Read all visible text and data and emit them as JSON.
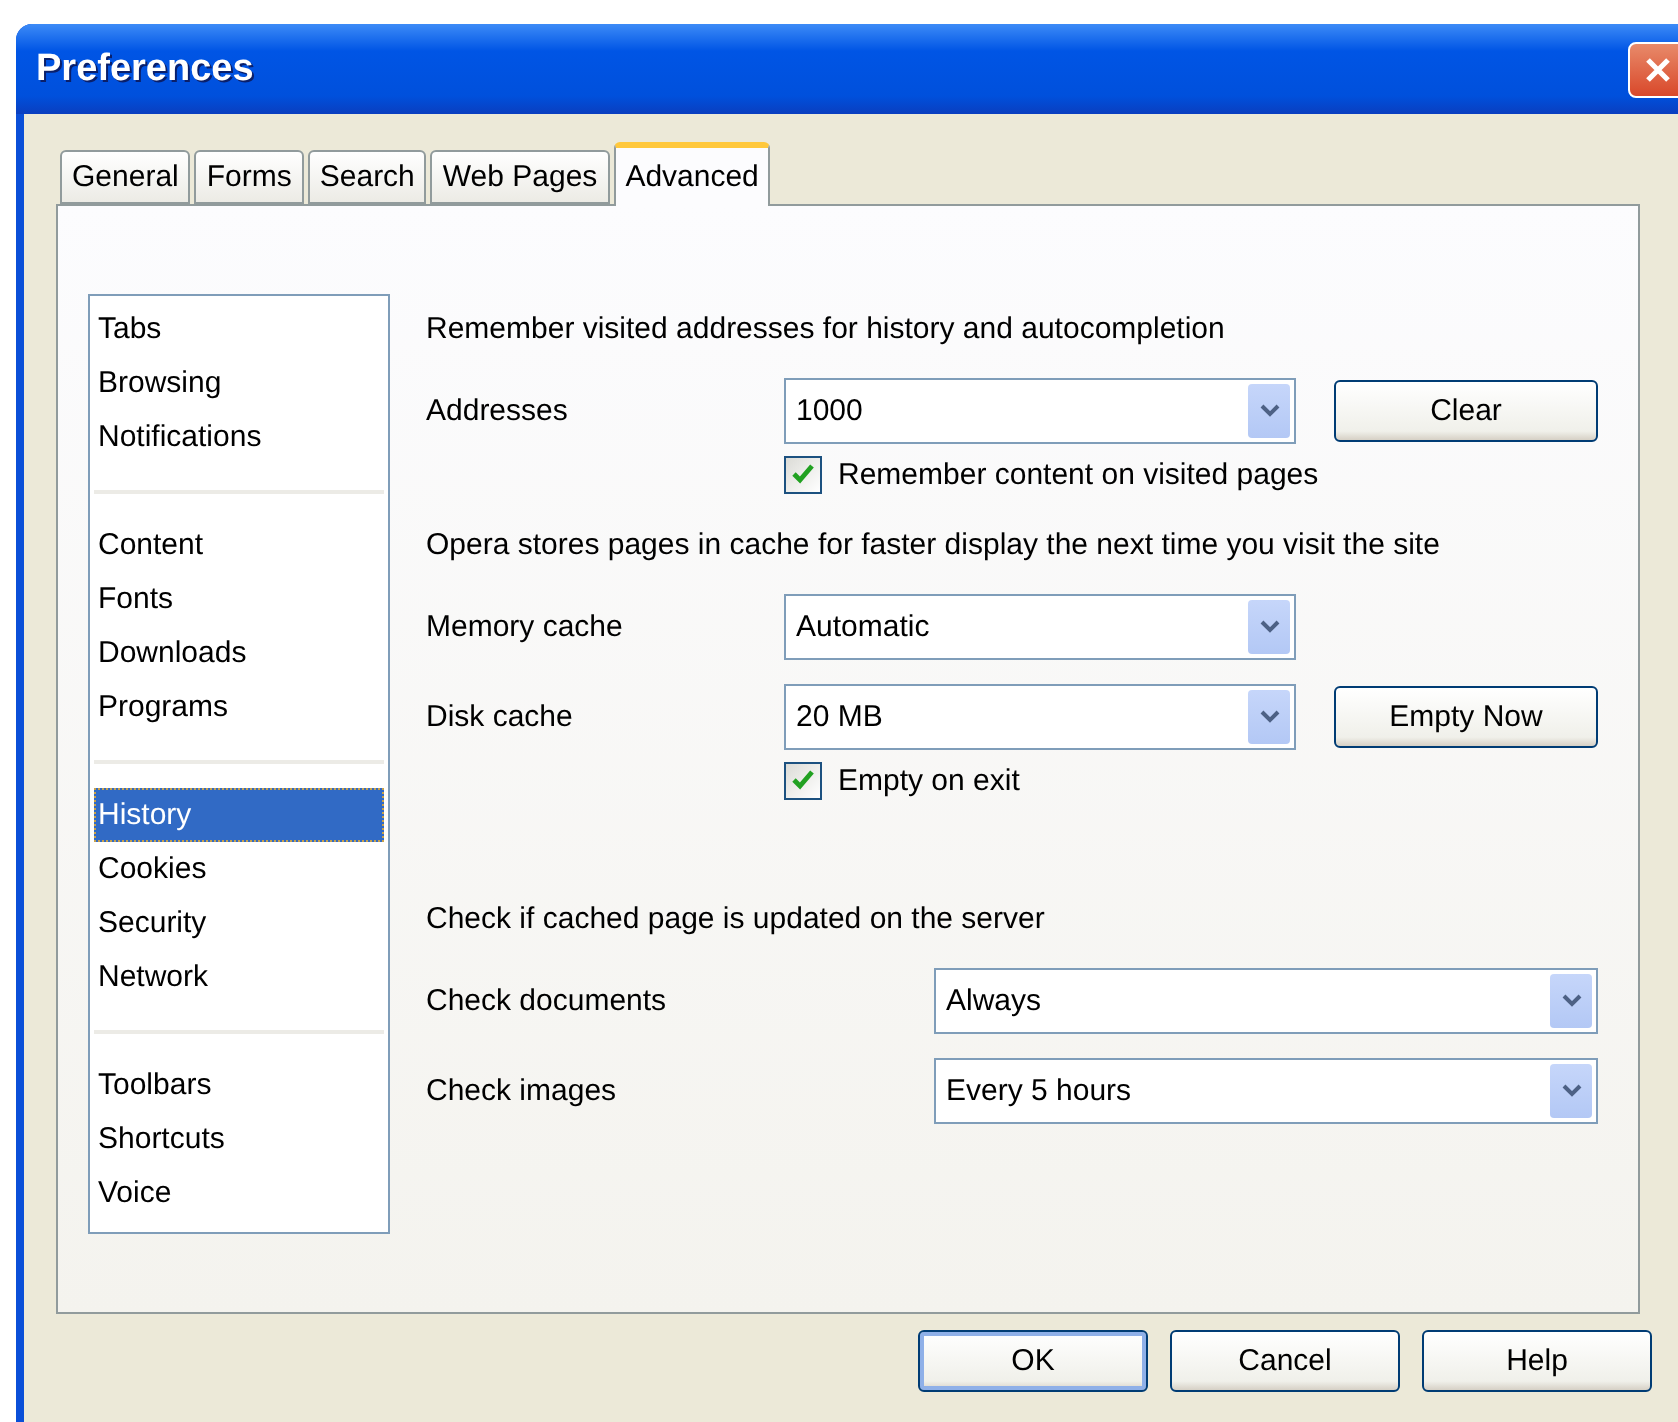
{
  "window": {
    "title": "Preferences"
  },
  "tabs": [
    {
      "label": "General",
      "selected": false
    },
    {
      "label": "Forms",
      "selected": false
    },
    {
      "label": "Search",
      "selected": false
    },
    {
      "label": "Web Pages",
      "selected": false
    },
    {
      "label": "Advanced",
      "selected": true
    }
  ],
  "sidebar": {
    "groups": [
      {
        "items": [
          {
            "label": "Tabs",
            "selected": false
          },
          {
            "label": "Browsing",
            "selected": false
          },
          {
            "label": "Notifications",
            "selected": false
          }
        ]
      },
      {
        "items": [
          {
            "label": "Content",
            "selected": false
          },
          {
            "label": "Fonts",
            "selected": false
          },
          {
            "label": "Downloads",
            "selected": false
          },
          {
            "label": "Programs",
            "selected": false
          }
        ]
      },
      {
        "items": [
          {
            "label": "History",
            "selected": true
          },
          {
            "label": "Cookies",
            "selected": false
          },
          {
            "label": "Security",
            "selected": false
          },
          {
            "label": "Network",
            "selected": false
          }
        ]
      },
      {
        "items": [
          {
            "label": "Toolbars",
            "selected": false
          },
          {
            "label": "Shortcuts",
            "selected": false
          },
          {
            "label": "Voice",
            "selected": false
          }
        ]
      }
    ]
  },
  "sections": [
    {
      "heading": "Remember visited addresses for history and autocompletion",
      "rows": [
        {
          "kind": "select",
          "label": "Addresses",
          "value": "1000",
          "button": "Clear"
        },
        {
          "kind": "checkbox",
          "label": "Remember content on visited pages",
          "checked": true
        }
      ]
    },
    {
      "heading": "Opera stores pages in cache for faster display the next time you visit the site",
      "rows": [
        {
          "kind": "select",
          "label": "Memory cache",
          "value": "Automatic"
        },
        {
          "kind": "select",
          "label": "Disk cache",
          "value": "20 MB",
          "button": "Empty Now"
        },
        {
          "kind": "checkbox",
          "label": "Empty on exit",
          "checked": true
        }
      ]
    },
    {
      "heading": "Check if cached page is updated on the server",
      "rows": [
        {
          "kind": "select",
          "label": "Check documents",
          "value": "Always"
        },
        {
          "kind": "select",
          "label": "Check images",
          "value": "Every 5 hours"
        }
      ]
    }
  ],
  "buttons": [
    {
      "label": "OK",
      "default": true
    },
    {
      "label": "Cancel",
      "default": false
    },
    {
      "label": "Help",
      "default": false
    }
  ]
}
